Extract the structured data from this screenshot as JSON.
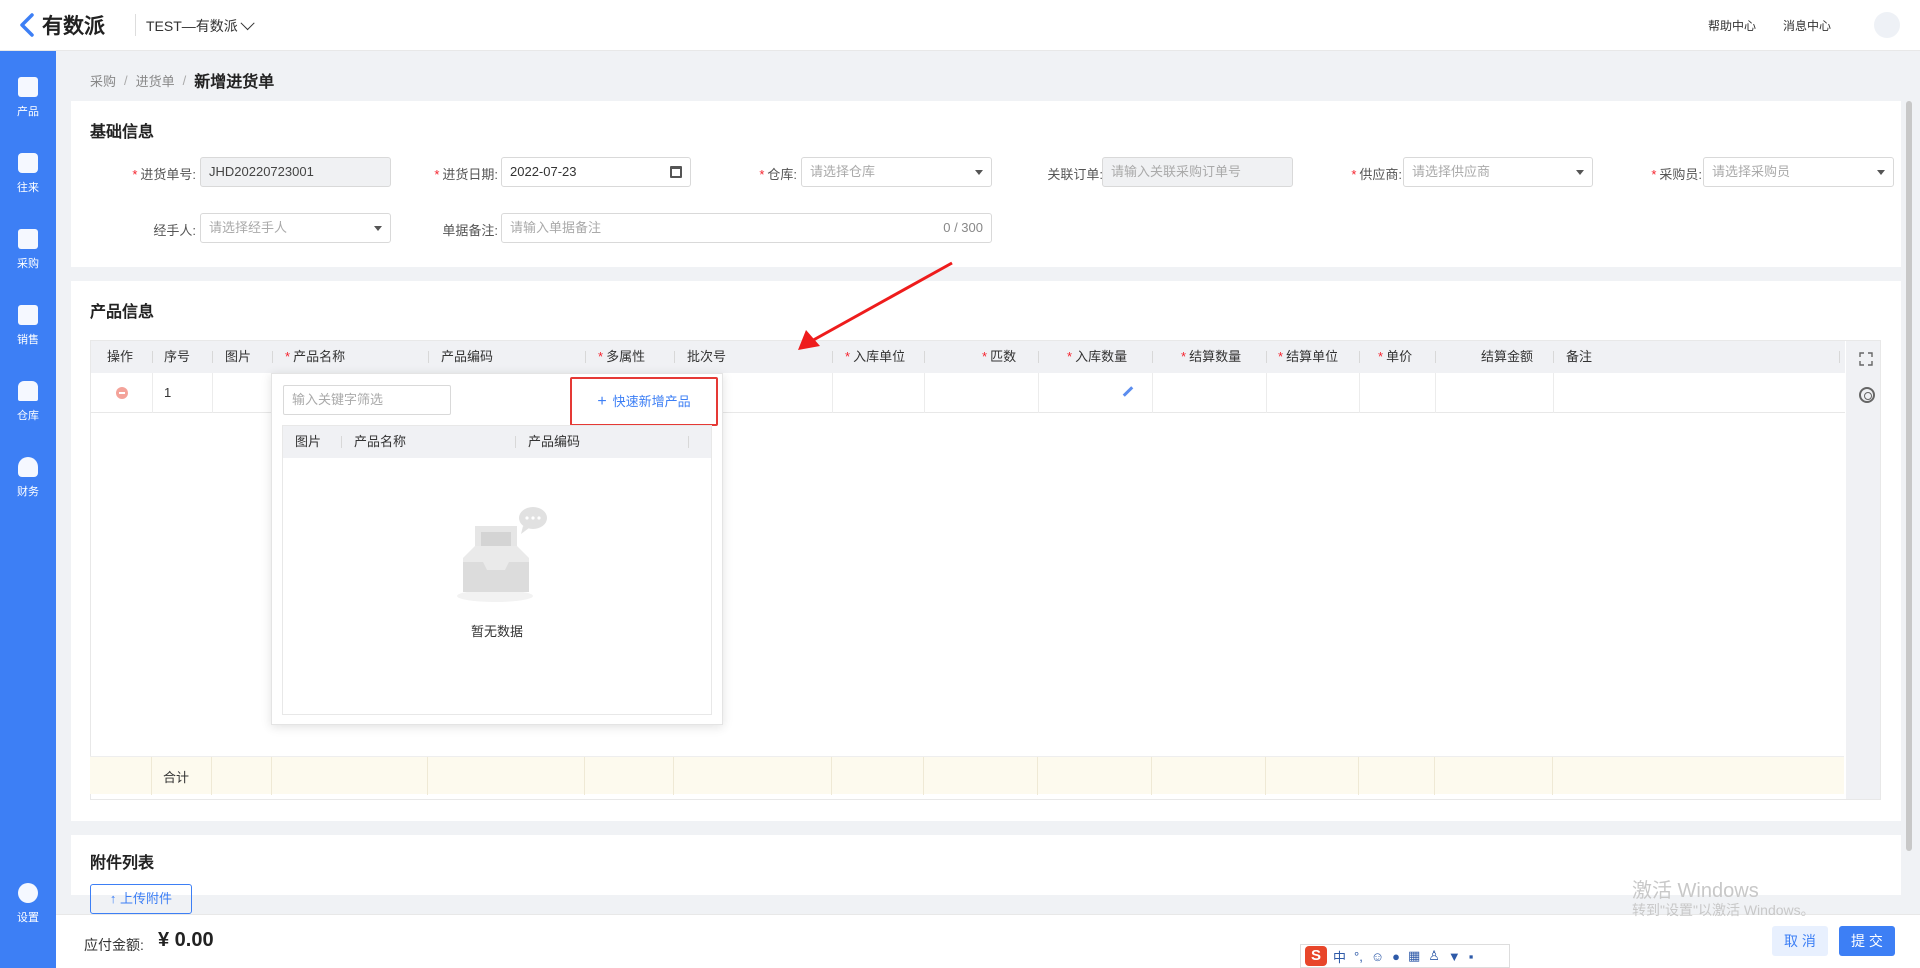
{
  "header": {
    "logo_text": "有数派",
    "tenant": "TEST—有数派",
    "help": "帮助中心",
    "messages": "消息中心"
  },
  "sidebar": {
    "items": [
      {
        "label": "产品",
        "icon": "box-icon"
      },
      {
        "label": "往来",
        "icon": "contact-icon"
      },
      {
        "label": "采购",
        "icon": "cart-icon"
      },
      {
        "label": "销售",
        "icon": "clipboard-icon"
      },
      {
        "label": "仓库",
        "icon": "warehouse-icon"
      },
      {
        "label": "财务",
        "icon": "money-bag-icon"
      }
    ],
    "settings": "设置",
    "active": "采购",
    "color": "#3d7ff5"
  },
  "breadcrumb": [
    "采购",
    "进货单",
    "新增进货单"
  ],
  "basic": {
    "title": "基础信息",
    "order_no_label": "进货单号:",
    "order_no": "JHD20220723001",
    "date_label": "进货日期:",
    "date": "2022-07-23",
    "warehouse_label": "仓库:",
    "warehouse_ph": "请选择仓库",
    "link_label": "关联订单:",
    "link_ph": "请输入关联采购订单号",
    "supplier_label": "供应商:",
    "supplier_ph": "请选择供应商",
    "buyer_label": "采购员:",
    "buyer_ph": "请选择采购员",
    "handler_label": "经手人:",
    "handler_ph": "请选择经手人",
    "remark_label": "单据备注:",
    "remark_ph": "请输入单据备注",
    "remark_count": "0 / 300"
  },
  "products": {
    "title": "产品信息",
    "columns": [
      {
        "label": "操作",
        "req": ""
      },
      {
        "label": "序号",
        "req": ""
      },
      {
        "label": "图片",
        "req": ""
      },
      {
        "label": "产品名称",
        "req": "*"
      },
      {
        "label": "产品编码",
        "req": ""
      },
      {
        "label": "多属性",
        "req": "*"
      },
      {
        "label": "批次号",
        "req": ""
      },
      {
        "label": "入库单位",
        "req": "*"
      },
      {
        "label": "匹数",
        "req": "*"
      },
      {
        "label": "入库数量",
        "req": "*"
      },
      {
        "label": "结算数量",
        "req": "*"
      },
      {
        "label": "结算单位",
        "req": "*"
      },
      {
        "label": "单价",
        "req": "*"
      },
      {
        "label": "结算金额",
        "req": ""
      },
      {
        "label": "备注",
        "req": ""
      }
    ],
    "row_index": "1",
    "total_label": "合计"
  },
  "popover": {
    "search_ph": "输入关键字筛选",
    "quick_add": "快速新增产品",
    "columns": [
      "图片",
      "产品名称",
      "产品编码"
    ],
    "empty": "暂无数据"
  },
  "attachments": {
    "title": "附件列表",
    "upload": "上传附件"
  },
  "footer": {
    "payable_label": "应付金额:",
    "payable_value": "¥ 0.00",
    "cancel": "取 消",
    "submit": "提 交"
  },
  "watermark": {
    "line1": "激活 Windows",
    "line2": "转到\"设置\"以激活 Windows。"
  },
  "ime": {
    "logo": "S",
    "lang": "中",
    "punct": "°,"
  }
}
